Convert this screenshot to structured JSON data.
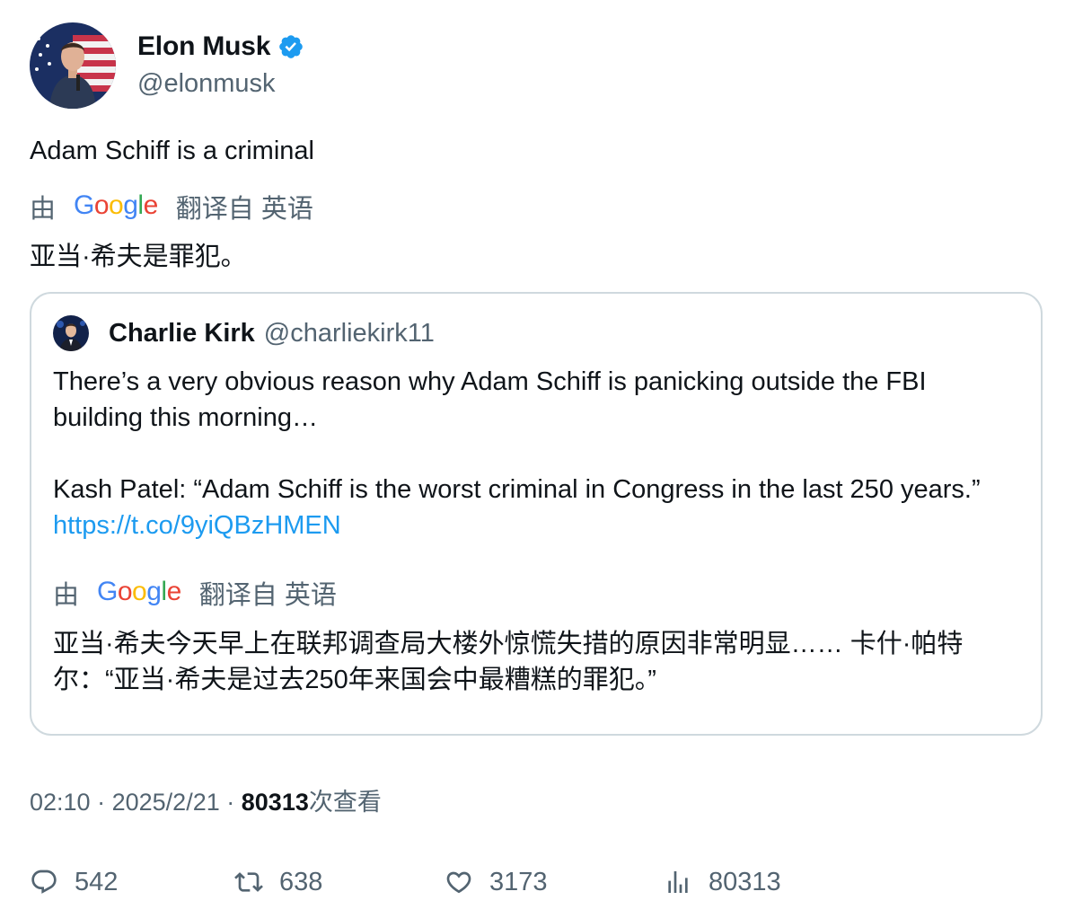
{
  "colors": {
    "text": "#0f1419",
    "secondary": "#536471",
    "link": "#1d9bf0",
    "verified": "#1d9bf0",
    "border": "#cfd9de"
  },
  "author": {
    "name": "Elon Musk",
    "handle": "@elonmusk",
    "verified": true
  },
  "tweet": {
    "text": "Adam Schiff is a criminal",
    "translation": {
      "by": "由",
      "provider": "Google",
      "from": "翻译自 英语",
      "text": "亚当·希夫是罪犯。"
    }
  },
  "quote": {
    "name": "Charlie Kirk",
    "handle": "@charliekirk11",
    "line1": "There’s a very obvious reason why Adam Schiff is panicking outside the FBI building this morning…",
    "line2": "Kash Patel: “Adam Schiff is the worst criminal in Congress in the last 250 years.”",
    "link": "https://t.co/9yiQBzHMEN",
    "translation": {
      "by": "由",
      "provider": "Google",
      "from": "翻译自 英语",
      "text": "亚当·希夫今天早上在联邦调查局大楼外惊慌失措的原因非常明显…… 卡什·帕特尔：“亚当·希夫是过去250年来国会中最糟糕的罪犯。”"
    }
  },
  "meta": {
    "time": "02:10",
    "sep": "·",
    "date": "2025/2/21",
    "views_count": "80313",
    "views_label": "次查看"
  },
  "actions": {
    "replies": "542",
    "retweets": "638",
    "likes": "3173",
    "views": "80313",
    "icons": [
      "reply-icon",
      "retweet-icon",
      "like-icon",
      "views-icon"
    ]
  }
}
